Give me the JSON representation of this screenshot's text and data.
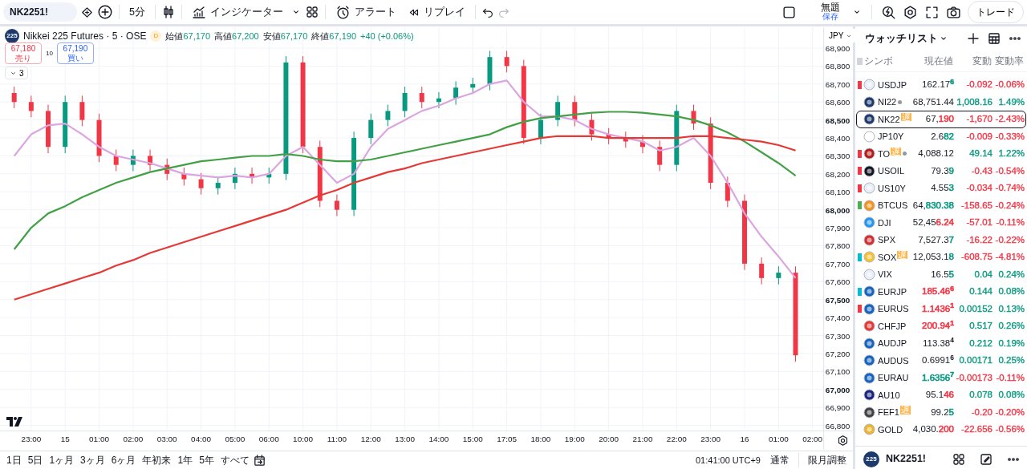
{
  "toolbar": {
    "symbol": "NK2251!",
    "interval": "5分",
    "indicators": "インジケーター",
    "alert": "アラート",
    "replay": "リプレイ",
    "layout_name": "無題",
    "save": "保存",
    "trade": "トレード"
  },
  "chart": {
    "logo": "225",
    "title": "Nikkei 225 Futures · 5 · OSE",
    "source_badge": "D",
    "ohlc": [
      {
        "label": "始値",
        "value": "67,170"
      },
      {
        "label": "高値",
        "value": "67,200"
      },
      {
        "label": "安値",
        "value": "67,170"
      },
      {
        "label": "終値",
        "value": "67,190"
      }
    ],
    "change": "+40 (+0.06%)",
    "order": {
      "sell_price": "67,180",
      "sell_label": "売り",
      "quantity": "10",
      "buy_price": "67,190",
      "buy_label": "買い"
    },
    "indicator_count": "3",
    "currency": "JPY",
    "chart_data": {
      "type": "candlestick",
      "grid": true,
      "ylim": [
        66771,
        69016
      ],
      "categories": [
        null,
        "23:00",
        null,
        "15",
        null,
        "01:00",
        null,
        "02:00",
        null,
        "03:00",
        null,
        "04:00",
        null,
        "05:00",
        null,
        "06:00",
        null,
        "10:00",
        null,
        "11:00",
        null,
        "12:00",
        null,
        "13:00",
        null,
        "14:00",
        null,
        "15:00",
        null,
        "17:05",
        null,
        "18:00",
        null,
        "19:00",
        null,
        "20:00",
        null,
        "21:00",
        null,
        "22:00",
        null,
        "23:00",
        null,
        "16",
        null,
        "01:00",
        null,
        "02:00"
      ],
      "ohlc": [
        [
          68650,
          68685,
          68565,
          68600
        ],
        [
          68600,
          68635,
          68515,
          68550
        ],
        [
          68550,
          68585,
          68315,
          68350
        ],
        [
          68350,
          68635,
          68315,
          68600
        ],
        [
          68600,
          68635,
          68465,
          68500
        ],
        [
          68500,
          68535,
          68265,
          68300
        ],
        [
          68300,
          68335,
          68215,
          68250
        ],
        [
          68250,
          68335,
          68215,
          68300
        ],
        [
          68300,
          68335,
          68215,
          68250
        ],
        [
          68250,
          68285,
          68165,
          68200
        ],
        [
          68200,
          68235,
          68135,
          68170
        ],
        [
          68170,
          68205,
          68085,
          68120
        ],
        [
          68120,
          68185,
          68085,
          68150
        ],
        [
          68150,
          68235,
          68115,
          68200
        ],
        [
          68200,
          68235,
          68145,
          68180
        ],
        [
          68180,
          68235,
          68145,
          68200
        ],
        [
          68200,
          68855,
          68165,
          68820
        ],
        [
          68820,
          68855,
          68315,
          68350
        ],
        [
          68350,
          68385,
          68015,
          68050
        ],
        [
          68050,
          68085,
          67965,
          68000
        ],
        [
          68000,
          68435,
          67965,
          68400
        ],
        [
          68400,
          68535,
          68365,
          68500
        ],
        [
          68500,
          68585,
          68465,
          68550
        ],
        [
          68550,
          68685,
          68515,
          68650
        ],
        [
          68650,
          68685,
          68565,
          68600
        ],
        [
          68600,
          68655,
          68565,
          68620
        ],
        [
          68620,
          68715,
          68585,
          68680
        ],
        [
          68680,
          68735,
          68645,
          68700
        ],
        [
          68700,
          68885,
          68665,
          68850
        ],
        [
          68850,
          68885,
          68765,
          68800
        ],
        [
          68800,
          68835,
          68365,
          68400
        ],
        [
          68400,
          68535,
          68365,
          68500
        ],
        [
          68500,
          68635,
          68465,
          68600
        ],
        [
          68600,
          68635,
          68465,
          68500
        ],
        [
          68500,
          68535,
          68385,
          68420
        ],
        [
          68420,
          68455,
          68365,
          68400
        ],
        [
          68400,
          68435,
          68345,
          68380
        ],
        [
          68380,
          68415,
          68315,
          68350
        ],
        [
          68350,
          68385,
          68215,
          68250
        ],
        [
          68250,
          68585,
          68215,
          68550
        ],
        [
          68550,
          68585,
          68445,
          68480
        ],
        [
          68480,
          68515,
          68115,
          68150
        ],
        [
          68150,
          68185,
          68015,
          68050
        ],
        [
          68050,
          68085,
          67665,
          67700
        ],
        [
          67700,
          67735,
          67585,
          67620
        ],
        [
          67620,
          67685,
          67585,
          67650
        ],
        [
          67650,
          67685,
          67155,
          67190
        ],
        null
      ],
      "series": [
        {
          "type": "line",
          "color": "#dba6e0",
          "values": [
            68300,
            68420,
            68470,
            68480,
            68420,
            68350,
            68300,
            68280,
            68260,
            68230,
            68200,
            68190,
            68180,
            68190,
            68180,
            68200,
            68300,
            68350,
            68250,
            68150,
            68200,
            68350,
            68450,
            68500,
            68550,
            68580,
            68620,
            68650,
            68700,
            68720,
            68600,
            68520,
            68520,
            68500,
            68450,
            68420,
            68400,
            68380,
            68330,
            68350,
            68400,
            68300,
            68150,
            67980,
            67850,
            67740,
            67620,
            null
          ]
        },
        {
          "type": "line",
          "color": "#43a047",
          "values": [
            67780,
            67900,
            67980,
            68020,
            68070,
            68110,
            68150,
            68180,
            68210,
            68230,
            68250,
            68270,
            68280,
            68290,
            68300,
            68300,
            68310,
            68300,
            68280,
            68270,
            68270,
            68280,
            68300,
            68320,
            68340,
            68360,
            68380,
            68400,
            68420,
            68460,
            68490,
            68510,
            68520,
            68530,
            68540,
            68545,
            68545,
            68540,
            68530,
            68520,
            68500,
            68470,
            68430,
            68380,
            68320,
            68260,
            68190,
            null
          ]
        },
        {
          "type": "line",
          "color": "#e53935",
          "values": [
            67500,
            67530,
            67560,
            67590,
            67620,
            67650,
            67690,
            67720,
            67760,
            67790,
            67820,
            67850,
            67880,
            67910,
            67940,
            67970,
            68000,
            68040,
            68080,
            68110,
            68150,
            68180,
            68210,
            68230,
            68260,
            68280,
            68300,
            68320,
            68340,
            68360,
            68380,
            68400,
            68410,
            68410,
            68410,
            68400,
            68400,
            68400,
            68400,
            68400,
            68410,
            68410,
            68400,
            68390,
            68380,
            68360,
            68330,
            null
          ]
        }
      ],
      "yticks": [
        {
          "value": 68900,
          "label": "68,900"
        },
        {
          "value": 68800,
          "label": "68,800"
        },
        {
          "value": 68700,
          "label": "68,700"
        },
        {
          "value": 68600,
          "label": "68,600"
        },
        {
          "value": 68500,
          "label": "68,500"
        },
        {
          "value": 68400,
          "label": "68,400"
        },
        {
          "value": 68300,
          "label": "68,300"
        },
        {
          "value": 68200,
          "label": "68,200"
        },
        {
          "value": 68100,
          "label": "68,100"
        },
        {
          "value": 68000,
          "label": "68,000"
        },
        {
          "value": 67900,
          "label": "67,900"
        },
        {
          "value": 67800,
          "label": "67,800"
        },
        {
          "value": 67700,
          "label": "67,700"
        },
        {
          "value": 67600,
          "label": "67,600"
        },
        {
          "value": 67500,
          "label": "67,500"
        },
        {
          "value": 67400,
          "label": "67,400"
        },
        {
          "value": 67300,
          "label": "67,300"
        },
        {
          "value": 67200,
          "label": "67,200"
        },
        {
          "value": 67100,
          "label": "67,100"
        },
        {
          "value": 67000,
          "label": "67,000"
        },
        {
          "value": 66900,
          "label": "66,900"
        },
        {
          "value": 66800,
          "label": "66,800"
        }
      ]
    }
  },
  "range_bar": {
    "ranges": [
      "1日",
      "5日",
      "1ヶ月",
      "3ヶ月",
      "6ヶ月",
      "年初来",
      "1年",
      "5年",
      "すべて"
    ],
    "clock": "01:41:00 UTC+9",
    "session": "通常",
    "adjust": "限月調整"
  },
  "watchlist": {
    "title": "ウォッチリスト",
    "columns": [
      "シンボ",
      "現在値",
      "変動",
      "変動率"
    ],
    "rows": [
      {
        "symbol": "USDJP",
        "flag": {
          "color": "#f23645"
        },
        "status_dot": false,
        "price": [
          {
            "text": "162.17",
            "sup": false
          },
          {
            "text": "6",
            "color": "#089981",
            "sup": true
          }
        ],
        "change": {
          "text": "-0.092",
          "color": "#f23645"
        },
        "pct": {
          "text": "-0.06%",
          "color": "#f23645"
        },
        "selected": false
      },
      {
        "symbol": "NI22",
        "status_dot": true,
        "price": [
          {
            "text": "68,751.44",
            "sup": false
          }
        ],
        "change": {
          "text": "1,008.16",
          "color": "#089981"
        },
        "pct": {
          "text": "1.49%",
          "color": "#089981"
        },
        "selected": false
      },
      {
        "symbol": "NK22",
        "badge": "遅",
        "status_dot": false,
        "price": [
          {
            "text": "67,",
            "sup": false
          },
          {
            "text": "190",
            "color": "#f23645",
            "sup": false
          }
        ],
        "change": {
          "text": "-1,670",
          "color": "#f23645"
        },
        "pct": {
          "text": "-2.43%",
          "color": "#f23645"
        },
        "selected": true
      },
      {
        "symbol": "JP10Y",
        "status_dot": false,
        "price": [
          {
            "text": "2.6",
            "sup": false
          },
          {
            "text": "82",
            "color": "#089981",
            "sup": false
          }
        ],
        "change": {
          "text": "-0.009",
          "color": "#f23645"
        },
        "pct": {
          "text": "-0.33%",
          "color": "#f23645"
        },
        "selected": false
      },
      {
        "symbol": "TO",
        "flag": {
          "color": "#f23645"
        },
        "badge": "遅",
        "status_dot": true,
        "price": [
          {
            "text": "4,088.12",
            "sup": false
          }
        ],
        "change": {
          "text": "49.14",
          "color": "#089981"
        },
        "pct": {
          "text": "1.22%",
          "color": "#089981"
        },
        "selected": false
      },
      {
        "symbol": "USOIL",
        "flag": {
          "color": "#f23645"
        },
        "status_dot": false,
        "price": [
          {
            "text": "79.3",
            "sup": false
          },
          {
            "text": "9",
            "color": "#089981",
            "sup": false
          }
        ],
        "change": {
          "text": "-0.43",
          "color": "#f23645"
        },
        "pct": {
          "text": "-0.54%",
          "color": "#f23645"
        },
        "selected": false
      },
      {
        "symbol": "US10Y",
        "flag": {
          "color": "#f23645"
        },
        "status_dot": false,
        "price": [
          {
            "text": "4.55",
            "sup": false
          },
          {
            "text": "3",
            "color": "#089981",
            "sup": false
          }
        ],
        "change": {
          "text": "-0.034",
          "color": "#f23645"
        },
        "pct": {
          "text": "-0.74%",
          "color": "#f23645"
        },
        "selected": false
      },
      {
        "symbol": "BTCUS",
        "flag": {
          "color": "#4caf50"
        },
        "status_dot": false,
        "price": [
          {
            "text": "64,",
            "sup": false
          },
          {
            "text": "830.38",
            "color": "#089981",
            "sup": false
          }
        ],
        "change": {
          "text": "-158.65",
          "color": "#f23645"
        },
        "pct": {
          "text": "-0.24%",
          "color": "#f23645"
        },
        "selected": false
      },
      {
        "symbol": "DJI",
        "status_dot": false,
        "price": [
          {
            "text": "52,45",
            "sup": false
          },
          {
            "text": "6.24",
            "color": "#f23645",
            "sup": false
          }
        ],
        "change": {
          "text": "-57.01",
          "color": "#f23645"
        },
        "pct": {
          "text": "-0.11%",
          "color": "#f23645"
        },
        "selected": false
      },
      {
        "symbol": "SPX",
        "status_dot": false,
        "price": [
          {
            "text": "7,527.3",
            "sup": false
          },
          {
            "text": "7",
            "color": "#089981",
            "sup": false
          }
        ],
        "change": {
          "text": "-16.22",
          "color": "#f23645"
        },
        "pct": {
          "text": "-0.22%",
          "color": "#f23645"
        },
        "selected": false
      },
      {
        "symbol": "SOX",
        "flag": {
          "color": "#00bcd4"
        },
        "badge": "遅",
        "status_dot": false,
        "price": [
          {
            "text": "12,053.1",
            "sup": false
          },
          {
            "text": "8",
            "color": "#089981",
            "sup": false
          }
        ],
        "change": {
          "text": "-608.75",
          "color": "#f23645"
        },
        "pct": {
          "text": "-4.81%",
          "color": "#f23645"
        },
        "selected": false
      },
      {
        "symbol": "VIX",
        "status_dot": false,
        "price": [
          {
            "text": "16.5",
            "sup": false
          },
          {
            "text": "5",
            "color": "#089981",
            "sup": false
          }
        ],
        "change": {
          "text": "0.04",
          "color": "#089981"
        },
        "pct": {
          "text": "0.24%",
          "color": "#089981"
        },
        "selected": false
      },
      {
        "symbol": "EURJP",
        "flag": {
          "color": "#00bcd4"
        },
        "status_dot": false,
        "price": [
          {
            "text": "185.46",
            "color": "#f23645",
            "sup": false
          },
          {
            "text": "6",
            "color": "#f23645",
            "sup": true
          }
        ],
        "change": {
          "text": "0.144",
          "color": "#089981"
        },
        "pct": {
          "text": "0.08%",
          "color": "#089981"
        },
        "selected": false
      },
      {
        "symbol": "EURUS",
        "flag": {
          "color": "#f23645"
        },
        "status_dot": false,
        "price": [
          {
            "text": "1.1436",
            "color": "#f23645",
            "sup": false
          },
          {
            "text": "1",
            "color": "#f23645",
            "sup": true
          }
        ],
        "change": {
          "text": "0.00152",
          "color": "#089981"
        },
        "pct": {
          "text": "0.13%",
          "color": "#089981"
        },
        "selected": false
      },
      {
        "symbol": "CHFJP",
        "status_dot": false,
        "price": [
          {
            "text": "200.94",
            "color": "#f23645",
            "sup": false
          },
          {
            "text": "1",
            "color": "#f23645",
            "sup": true
          }
        ],
        "change": {
          "text": "0.517",
          "color": "#089981"
        },
        "pct": {
          "text": "0.26%",
          "color": "#089981"
        },
        "selected": false
      },
      {
        "symbol": "AUDJP",
        "status_dot": false,
        "price": [
          {
            "text": "113.38",
            "sup": false
          },
          {
            "text": "4",
            "sup": true
          }
        ],
        "change": {
          "text": "0.212",
          "color": "#089981"
        },
        "pct": {
          "text": "0.19%",
          "color": "#089981"
        },
        "selected": false
      },
      {
        "symbol": "AUDUS",
        "status_dot": false,
        "price": [
          {
            "text": "0.6991",
            "sup": false
          },
          {
            "text": "6",
            "sup": true
          }
        ],
        "change": {
          "text": "0.00171",
          "color": "#089981"
        },
        "pct": {
          "text": "0.25%",
          "color": "#089981"
        },
        "selected": false
      },
      {
        "symbol": "EURAU",
        "status_dot": false,
        "price": [
          {
            "text": "1.6356",
            "color": "#089981",
            "sup": false
          },
          {
            "text": "7",
            "color": "#089981",
            "sup": true
          }
        ],
        "change": {
          "text": "-0.00173",
          "color": "#f23645"
        },
        "pct": {
          "text": "-0.11%",
          "color": "#f23645"
        },
        "selected": false
      },
      {
        "symbol": "AU10",
        "status_dot": false,
        "price": [
          {
            "text": "95.1",
            "sup": false
          },
          {
            "text": "46",
            "color": "#f23645",
            "sup": false
          }
        ],
        "change": {
          "text": "0.078",
          "color": "#089981"
        },
        "pct": {
          "text": "0.08%",
          "color": "#089981"
        },
        "selected": false
      },
      {
        "symbol": "FEF1",
        "badge": "遅",
        "status_dot": false,
        "price": [
          {
            "text": "99.2",
            "sup": false
          },
          {
            "text": "5",
            "color": "#089981",
            "sup": false
          }
        ],
        "change": {
          "text": "-0.20",
          "color": "#f23645"
        },
        "pct": {
          "text": "-0.20%",
          "color": "#f23645"
        },
        "selected": false
      },
      {
        "symbol": "GOLD",
        "status_dot": false,
        "price": [
          {
            "text": "4,030.",
            "sup": false
          },
          {
            "text": "200",
            "color": "#f23645",
            "sup": false
          }
        ],
        "change": {
          "text": "-22.656",
          "color": "#f23645"
        },
        "pct": {
          "text": "-0.56%",
          "color": "#f23645"
        },
        "selected": false
      }
    ],
    "footer": {
      "logo": "225",
      "symbol": "NK2251!"
    }
  }
}
